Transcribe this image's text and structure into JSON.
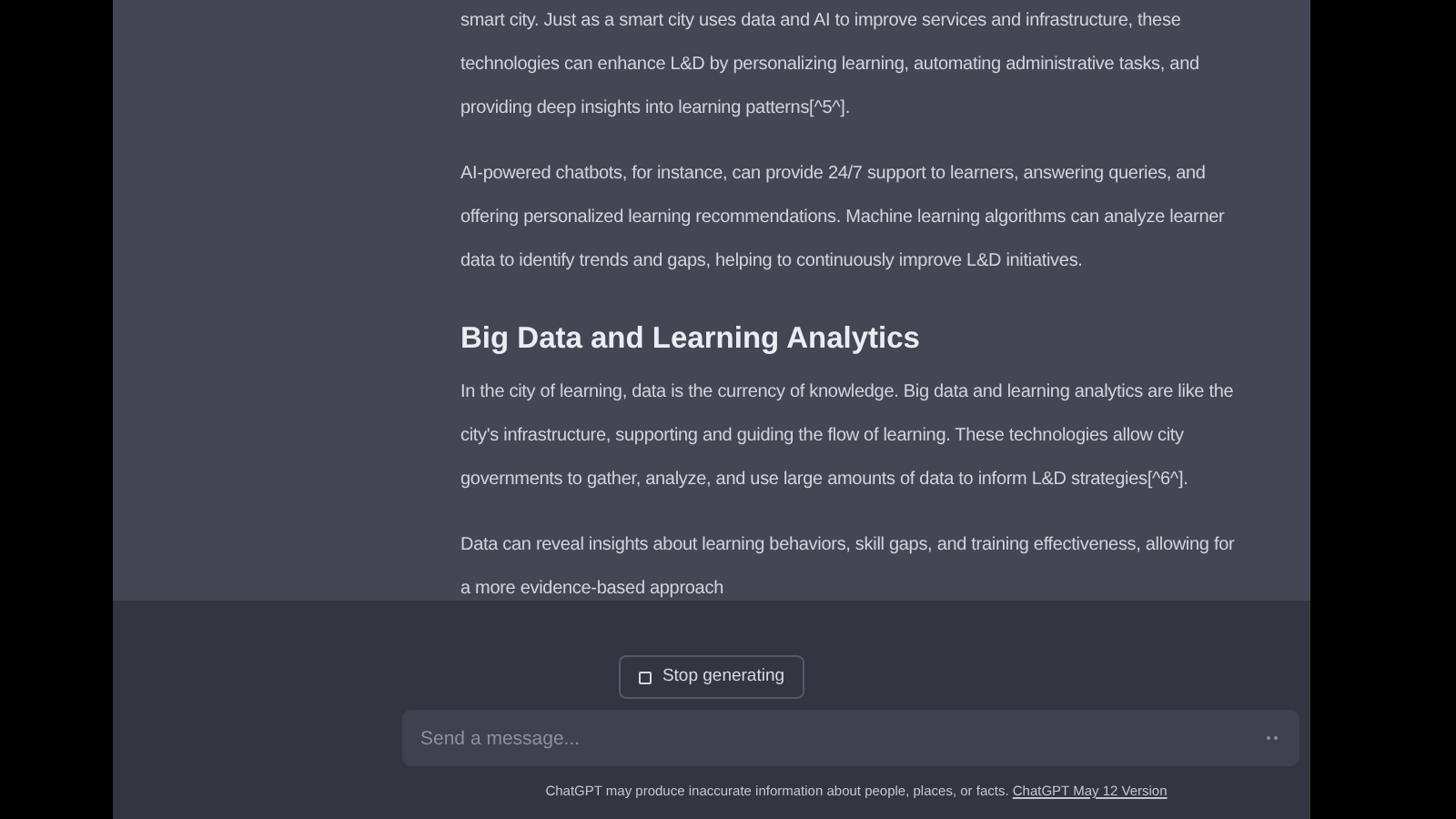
{
  "message": {
    "blocks": [
      {
        "kind": "paragraph",
        "text": "smart city. Just as a smart city uses data and AI to improve services and infrastructure, these technologies can enhance L&D by personalizing learning, automating administrative tasks, and providing deep insights into learning patterns[^5^]."
      },
      {
        "kind": "paragraph",
        "text": "AI-powered chatbots, for instance, can provide 24/7 support to learners, answering queries, and offering personalized learning recommendations. Machine learning algorithms can analyze learner data to identify trends and gaps, helping to continuously improve L&D initiatives."
      },
      {
        "kind": "heading",
        "text": "Big Data and Learning Analytics"
      },
      {
        "kind": "paragraph",
        "text": "In the city of learning, data is the currency of knowledge. Big data and learning analytics are like the city's infrastructure, supporting and guiding the flow of learning. These technologies allow city governments to gather, analyze, and use large amounts of data to inform L&D strategies[^6^]."
      },
      {
        "kind": "paragraph",
        "text": "Data can reveal insights about learning behaviors, skill gaps, and training effectiveness, allowing for a more evidence-based approach"
      }
    ]
  },
  "stop_button": "Stop generating",
  "composer": {
    "placeholder": "Send a message..."
  },
  "footer": {
    "text": "ChatGPT may produce inaccurate information about people, places, or facts.",
    "link": "ChatGPT May 12 Version"
  }
}
